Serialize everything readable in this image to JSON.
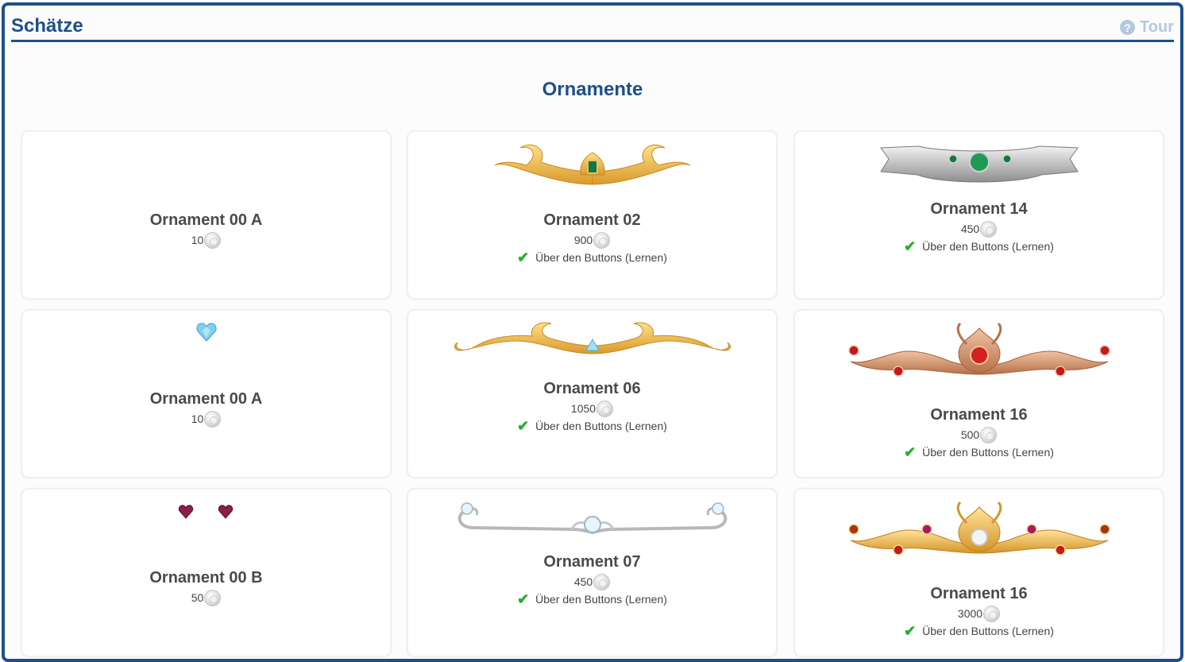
{
  "header": {
    "title": "Schätze",
    "tour_label": "Tour",
    "tour_icon": "question-circle-icon"
  },
  "section": {
    "title": "Ornamente"
  },
  "colors": {
    "brand": "#1d4f8b",
    "tour": "#b4c8df",
    "check": "#22b02a"
  },
  "cards": [
    {
      "name": "Ornament 00 A",
      "price": "10",
      "requirement": "",
      "image": "none"
    },
    {
      "name": "Ornament 02",
      "price": "900",
      "requirement": "Über den Buttons (Lernen)",
      "image": "gold-scroll-emerald"
    },
    {
      "name": "Ornament 14",
      "price": "450",
      "requirement": "Über den Buttons (Lernen)",
      "image": "silver-ribbon-emeralds"
    },
    {
      "name": "Ornament 00 A",
      "price": "10",
      "requirement": "",
      "image": "blue-heart-gem"
    },
    {
      "name": "Ornament 06",
      "price": "1050",
      "requirement": "Über den Buttons (Lernen)",
      "image": "gold-scroll-triangle-gem"
    },
    {
      "name": "Ornament 16",
      "price": "500",
      "requirement": "Über den Buttons (Lernen)",
      "image": "copper-flower-rubies"
    },
    {
      "name": "Ornament 00 B",
      "price": "50",
      "requirement": "",
      "image": "two-purple-hearts"
    },
    {
      "name": "Ornament 07",
      "price": "450",
      "requirement": "Über den Buttons (Lernen)",
      "image": "silver-swirl-diamonds"
    },
    {
      "name": "Ornament 16",
      "price": "3000",
      "requirement": "Über den Buttons (Lernen)",
      "image": "gold-flower-multigem"
    }
  ]
}
